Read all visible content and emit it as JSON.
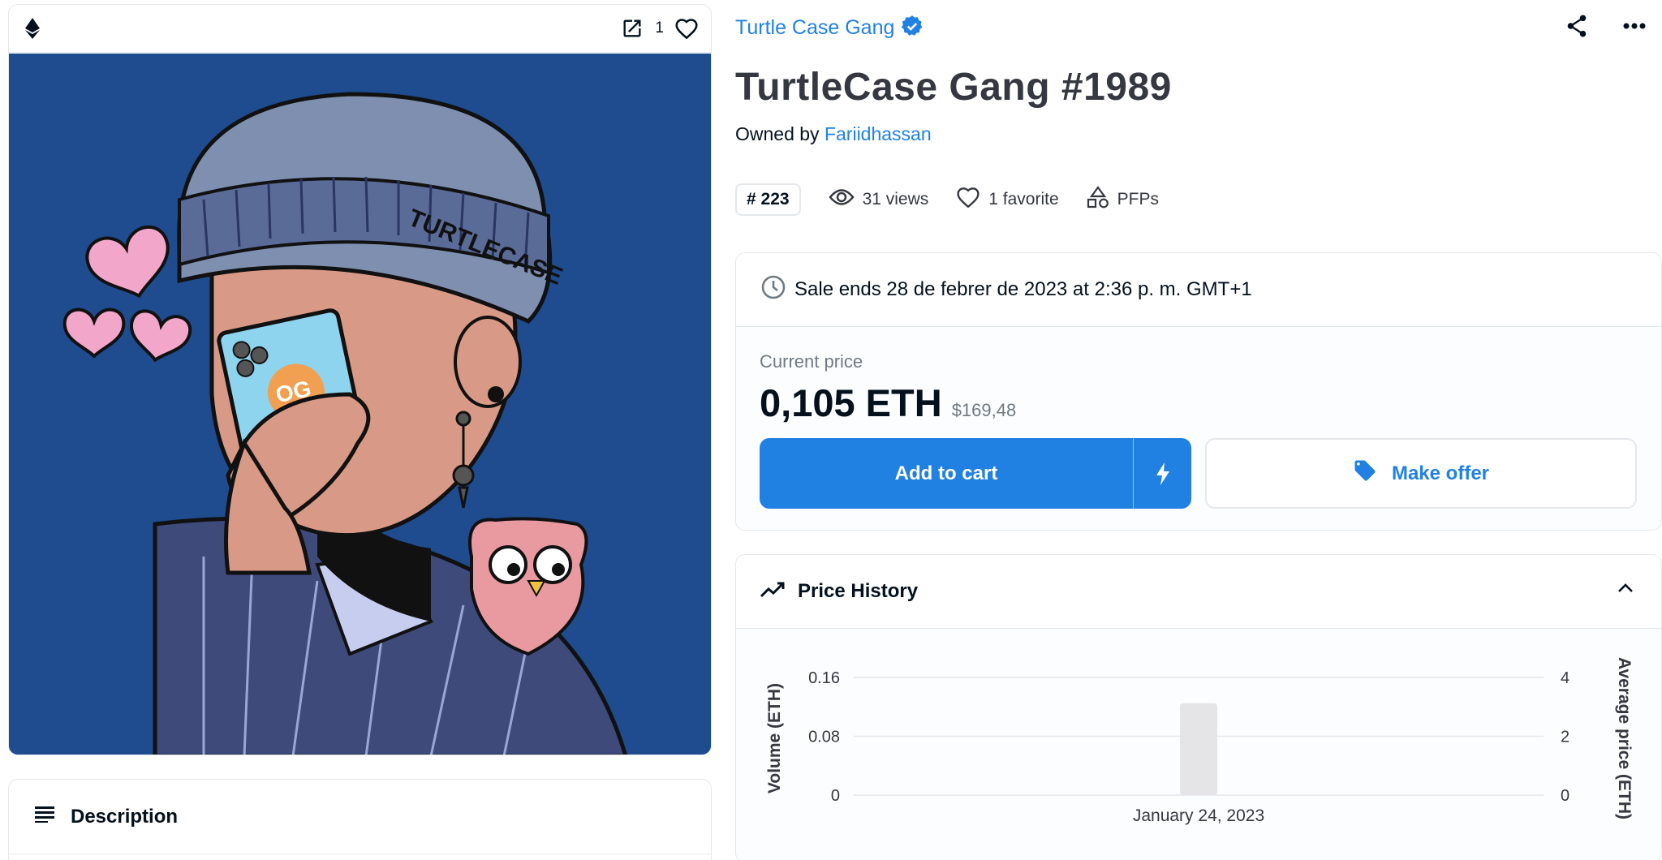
{
  "media": {
    "chain_icon": "ethereum-icon",
    "favorite_count": "1"
  },
  "description": {
    "title": "Description"
  },
  "collection": {
    "name": "Turtle Case Gang",
    "verified": true
  },
  "item": {
    "title": "TurtleCase Gang #1989",
    "owned_by_label": "Owned by",
    "owner": "Fariidhassan"
  },
  "stats": {
    "rank": "# 223",
    "views": "31 views",
    "favorites": "1 favorite",
    "category": "PFPs"
  },
  "sale": {
    "ends_text": "Sale ends 28 de febrer de 2023 at 2:36 p. m. GMT+1",
    "current_price_label": "Current price",
    "price_eth": "0,105 ETH",
    "price_usd": "$169,48",
    "add_to_cart_label": "Add to cart",
    "make_offer_label": "Make offer"
  },
  "price_history": {
    "title": "Price History"
  },
  "colors": {
    "accent": "#2081e2",
    "artwork_background": "#1f4b8f",
    "bar": "#e5e5e8"
  },
  "chart_data": {
    "type": "bar",
    "categories": [
      "January 24, 2023"
    ],
    "values": [
      0.125
    ],
    "ylabel": "Volume (ETH)",
    "ylim": [
      0,
      0.16
    ],
    "yticks": [
      "0",
      "0.08",
      "0.16"
    ],
    "y2label": "Average price (ETH)",
    "y2lim": [
      0,
      4
    ],
    "y2ticks": [
      "0",
      "2",
      "4"
    ],
    "grid": true
  }
}
